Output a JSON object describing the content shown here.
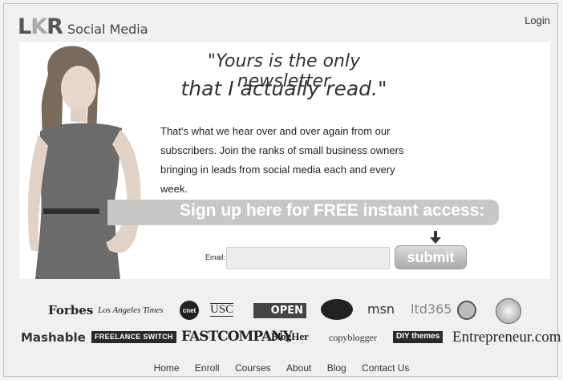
{
  "header": {
    "logo_letters": [
      "L",
      "K",
      "R"
    ],
    "logo_subtitle": "Social Media",
    "login_label": "Login"
  },
  "hero": {
    "quote_line1": "\"Yours is the only newsletter",
    "quote_line2": "that I actually read.\"",
    "body": "That's what we hear over and over again from our subscribers. Join the ranks of small business owners bringing in leads from social media each and every week.",
    "signup_banner": "Sign up here for FREE instant access:",
    "email_label": "Email:",
    "email_value": "",
    "submit_label": "submit"
  },
  "press": {
    "row1": [
      "Forbes",
      "Los Angeles Times",
      "cnet",
      "USC",
      "OPEN",
      "msn",
      "ltd365"
    ],
    "row2": [
      "Mashable",
      "FREELANCE SWITCH",
      "FASTCOMPANY",
      "BlogHer",
      "copyblogger",
      "DIY themes",
      "Entrepreneur.com"
    ]
  },
  "nav": {
    "items": [
      "Home",
      "Enroll",
      "Courses",
      "About",
      "Blog",
      "Contact Us"
    ]
  },
  "colors": {
    "page_bg": "#f0f0f0",
    "hero_bg": "#ffffff",
    "banner_bg": "#c7c7c7",
    "text": "#333333"
  },
  "icons": {
    "arrow": "down-arrow-icon",
    "photo": "woman-photo"
  }
}
